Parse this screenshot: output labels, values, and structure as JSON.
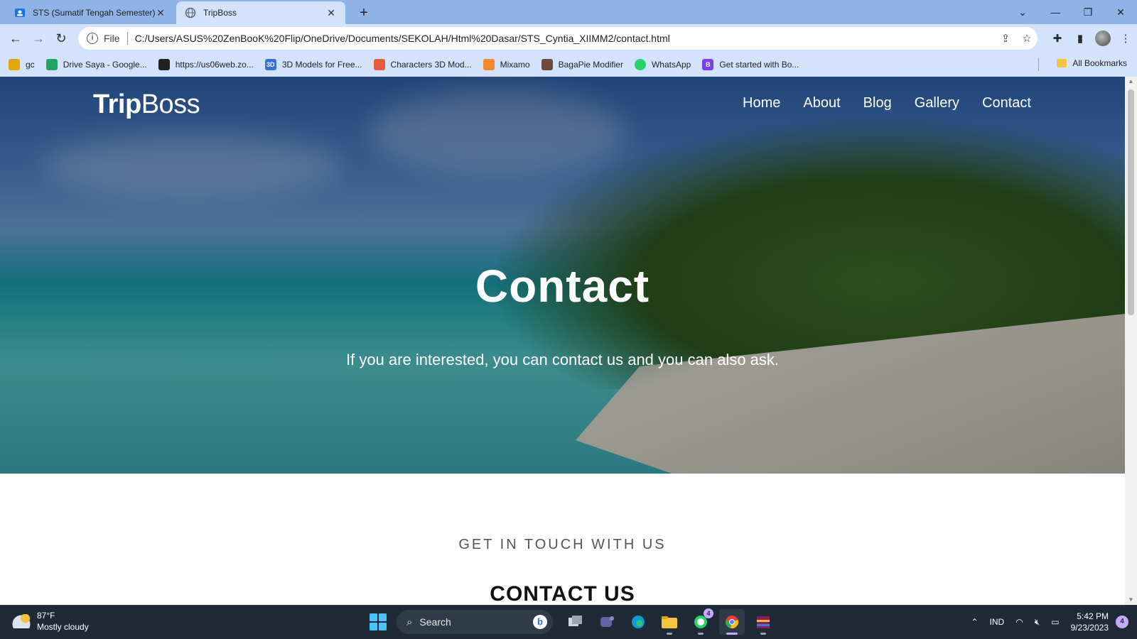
{
  "browser": {
    "tabs": [
      {
        "title": "STS (Sumatif Tengah Semester) C",
        "active": false
      },
      {
        "title": "TripBoss",
        "active": true
      }
    ],
    "new_tab_icon": "plus-icon",
    "address": {
      "scheme": "File",
      "url": "C:/Users/ASUS%20ZenBooK%20Flip/OneDrive/Documents/SEKOLAH/Html%20Dasar/STS_Cyntia_XIIMM2/contact.html"
    },
    "bookmarks": [
      {
        "label": "gc",
        "icon_color": "#e0a800"
      },
      {
        "label": "Drive Saya - Google...",
        "icon_color": "#1fa463"
      },
      {
        "label": "https://us06web.zo...",
        "icon_color": "#222222"
      },
      {
        "label": "3D Models for Free...",
        "icon_color": "#3b6fd6"
      },
      {
        "label": "Characters 3D Mod...",
        "icon_color": "#e65c3c"
      },
      {
        "label": "Mixamo",
        "icon_color": "#f08a2c"
      },
      {
        "label": "BagaPie Modifier",
        "icon_color": "#6b4b3e"
      },
      {
        "label": "WhatsApp",
        "icon_color": "#25d366"
      },
      {
        "label": "Get started with Bo...",
        "icon_color": "#7a3ff0"
      }
    ],
    "all_bookmarks_label": "All Bookmarks"
  },
  "site": {
    "brand_bold": "Trip",
    "brand_light": "Boss",
    "nav": [
      "Home",
      "About",
      "Blog",
      "Gallery",
      "Contact"
    ],
    "hero_title": "Contact",
    "hero_subtitle": "If you are interested, you can contact us and you can also ask.",
    "section_kicker": "GET IN TOUCH WITH US",
    "section_title": "CONTACT US"
  },
  "taskbar": {
    "weather_temp": "87°F",
    "weather_desc": "Mostly cloudy",
    "search_placeholder": "Search",
    "whatsapp_badge": "4",
    "language": "IND",
    "time": "5:42 PM",
    "date": "9/23/2023",
    "notification_count": "4"
  },
  "colors": {
    "tabbar": "#8fb3e6",
    "toolbar": "#d3e3fd",
    "taskbar": "#1f2a36",
    "accent_badge": "#c4a9ff"
  }
}
